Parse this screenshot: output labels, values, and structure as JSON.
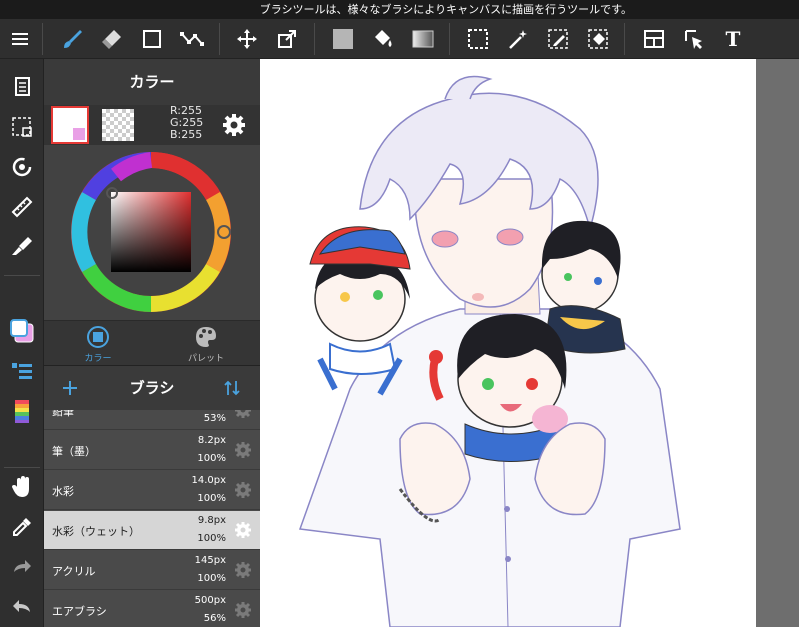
{
  "tooltip": "ブラシツールは、様々なブラシによりキャンバスに描画を行うツールです。",
  "toolbar": {
    "icons": [
      "menu-icon",
      "brush-icon",
      "eraser-icon",
      "rect-select-icon",
      "line-tool-icon",
      "move-icon",
      "transform-icon",
      "fill-color-icon",
      "bucket-icon",
      "gradient-icon",
      "marquee-icon",
      "magic-wand-icon",
      "select-pen-icon",
      "select-eraser-icon",
      "layout-icon",
      "select-layer-icon",
      "text-icon"
    ]
  },
  "rail": {
    "icons": [
      "pages-icon",
      "selection-icon",
      "rotate-icon",
      "ruler-icon",
      "brush-control-icon",
      "color-swatch-icon",
      "layers-icon",
      "color-palette-icon",
      "hand-icon",
      "eyedropper-icon",
      "redo-icon",
      "undo-icon"
    ]
  },
  "color_panel": {
    "title": "カラー",
    "rgb": {
      "r": "R:255",
      "g": "G:255",
      "b": "B:255"
    },
    "tabs": [
      {
        "label": "カラー",
        "active": true
      },
      {
        "label": "パレット",
        "active": false
      }
    ],
    "accent": "#4aa3df"
  },
  "brush_panel": {
    "title": "ブラシ",
    "items": [
      {
        "name": "鉛筆",
        "size": "",
        "opacity": "53%"
      },
      {
        "name": "筆（墨）",
        "size": "8.2px",
        "opacity": "100%"
      },
      {
        "name": "水彩",
        "size": "14.0px",
        "opacity": "100%"
      },
      {
        "name": "水彩（ウェット）",
        "size": "9.8px",
        "opacity": "100%",
        "selected": true
      },
      {
        "name": "アクリル",
        "size": "145px",
        "opacity": "100%"
      },
      {
        "name": "エアブラシ",
        "size": "500px",
        "opacity": "56%"
      }
    ]
  }
}
